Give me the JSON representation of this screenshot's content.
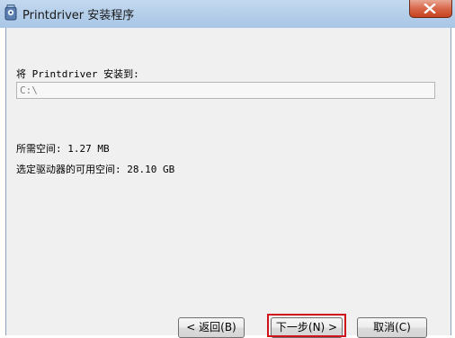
{
  "window": {
    "title": "Printdriver 安装程序",
    "icon": "installer-icon",
    "close_icon": "close-icon"
  },
  "install": {
    "prompt": "将 Printdriver 安装到:",
    "path_value": "C:\\"
  },
  "space": {
    "required": "所需空间: 1.27 MB",
    "available": "选定驱动器的可用空间: 28.10 GB"
  },
  "buttons": {
    "back": "< 返回(B)",
    "next": "下一步(N) >",
    "cancel": "取消(C)"
  },
  "colors": {
    "highlight": "#d0121b",
    "close_button": "#c4411e"
  }
}
